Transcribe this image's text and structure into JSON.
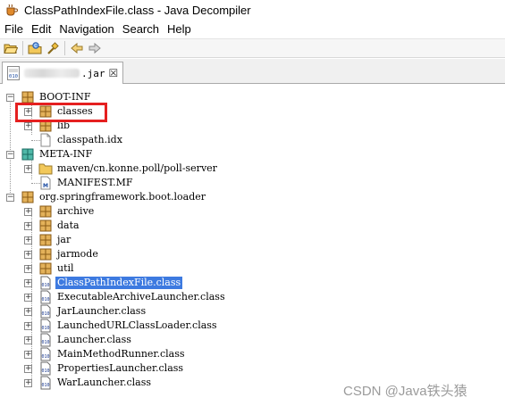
{
  "window": {
    "title": "ClassPathIndexFile.class - Java Decompiler"
  },
  "menu": [
    "File",
    "Edit",
    "Navigation",
    "Search",
    "Help"
  ],
  "toolbar": {
    "icons": [
      "open-file-icon",
      "open-type-icon",
      "search-icon",
      "back-icon",
      "forward-icon"
    ]
  },
  "tab": {
    "label": ".jar",
    "close": "☒"
  },
  "tree": {
    "boot_inf": "BOOT-INF",
    "classes": "classes",
    "lib": "lib",
    "classpath_idx": "classpath.idx",
    "meta_inf": "META-INF",
    "maven": "maven/cn.konne.poll/poll-server",
    "manifest": "MANIFEST.MF",
    "loader": "org.springframework.boot.loader",
    "loader_children": [
      {
        "label": "archive",
        "kind": "package"
      },
      {
        "label": "data",
        "kind": "package"
      },
      {
        "label": "jar",
        "kind": "package"
      },
      {
        "label": "jarmode",
        "kind": "package"
      },
      {
        "label": "util",
        "kind": "package"
      },
      {
        "label": "ClassPathIndexFile.class",
        "kind": "class",
        "selected": true
      },
      {
        "label": "ExecutableArchiveLauncher.class",
        "kind": "class"
      },
      {
        "label": "JarLauncher.class",
        "kind": "class"
      },
      {
        "label": "LaunchedURLClassLoader.class",
        "kind": "class"
      },
      {
        "label": "Launcher.class",
        "kind": "class"
      },
      {
        "label": "MainMethodRunner.class",
        "kind": "class"
      },
      {
        "label": "PropertiesLauncher.class",
        "kind": "class"
      },
      {
        "label": "WarLauncher.class",
        "kind": "class"
      }
    ]
  },
  "watermark": "CSDN @Java铁头猿",
  "colors": {
    "selection": "#3d7ae0",
    "highlight": "#e52020",
    "package": "#c89a3c"
  }
}
